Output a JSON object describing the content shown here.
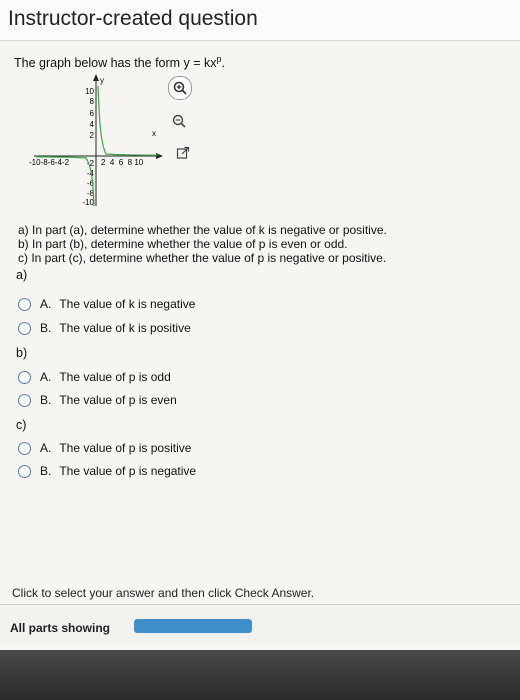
{
  "header": {
    "title": "Instructor-created question"
  },
  "question": {
    "prefix": "The graph below has the form y = kx",
    "exponent": "p",
    "suffix": "."
  },
  "graph": {
    "y_label": "y",
    "x_label": "x",
    "y_ticks_pos": [
      "10",
      "8",
      "6",
      "4",
      "2"
    ],
    "y_ticks_neg": [
      "-2",
      "-4",
      "-6",
      "-8",
      "-10"
    ],
    "x_ticks_neg": "-10-8-6-4-2",
    "x_ticks_pos": "2  4  6  8 10"
  },
  "tools": {
    "zoom_in": "zoom-in-icon",
    "zoom_out": "zoom-out-icon",
    "expand": "expand-icon"
  },
  "instructions": [
    "a) In part (a), determine whether the value of k is negative or positive.",
    "b) In part (b), determine whether the value of  p is even or odd.",
    "c) In part (c), determine whether the value of p is negative or positive."
  ],
  "sections": [
    {
      "label": "a)",
      "options": [
        {
          "letter": "A.",
          "text": "The value of k is negative"
        },
        {
          "letter": "B.",
          "text": "The value of k is positive"
        }
      ]
    },
    {
      "label": "b)",
      "options": [
        {
          "letter": "A.",
          "text": "The value of p is odd"
        },
        {
          "letter": "B.",
          "text": "The value of p is even"
        }
      ]
    },
    {
      "label": "c)",
      "options": [
        {
          "letter": "A.",
          "text": "The value of p is positive"
        },
        {
          "letter": "B.",
          "text": "The value of p is negative"
        }
      ]
    }
  ],
  "footer": {
    "instruction": "Click to select your answer and then click Check Answer.",
    "parts_label": "All parts showing",
    "progress": 1.0
  },
  "colors": {
    "accent": "#3d8ec9",
    "radio": "#4a7fb5"
  }
}
